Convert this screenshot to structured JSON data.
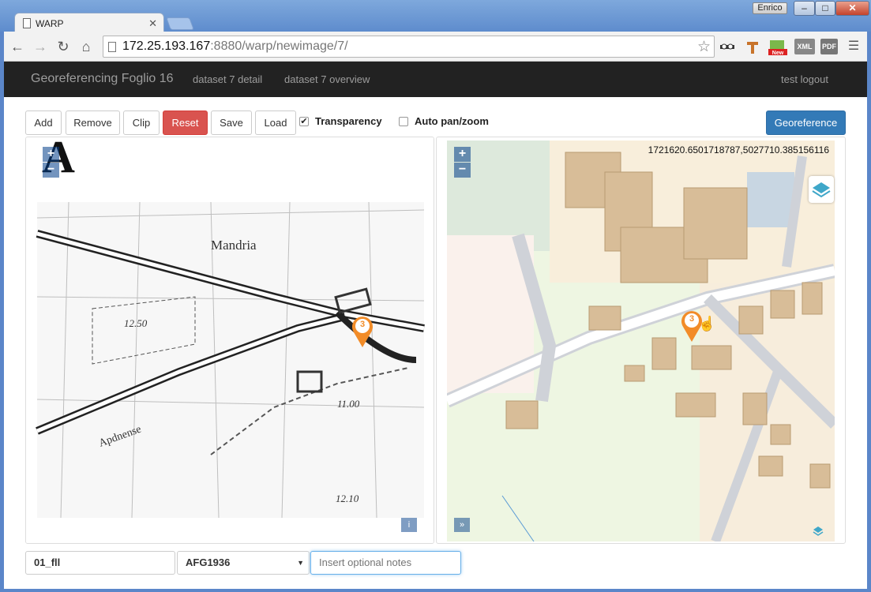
{
  "browser": {
    "tab_title": "WARP",
    "url_host": "172.25.193.167",
    "url_rest": ":8880/warp/newimage/7/",
    "user": "Enrico",
    "extensions": [
      "incognito-icon",
      "hammer-icon",
      "new-badge-icon",
      "xml-icon",
      "pdf-icon"
    ],
    "ext_labels": {
      "new": "New",
      "xml": "XML",
      "pdf": "PDF"
    }
  },
  "app": {
    "brand": "Georeferencing Foglio 16",
    "nav": [
      "dataset 7 detail",
      "dataset 7 overview"
    ],
    "user_link": "test logout"
  },
  "toolbar": {
    "add": "Add",
    "remove": "Remove",
    "clip": "Clip",
    "reset": "Reset",
    "save": "Save",
    "load": "Load",
    "transparency": "Transparency",
    "transparency_checked": true,
    "autopan": "Auto pan/zoom",
    "autopan_checked": false,
    "georeference": "Georeference",
    "colors": {
      "reset": "#d9534f",
      "georeference": "#337ab7"
    }
  },
  "left_map": {
    "labels": [
      "Mandria",
      "12.50",
      "11.00",
      "Apdnense",
      "12.10"
    ],
    "header_letter": "A",
    "marker": "3",
    "zoom_in": "+",
    "zoom_out": "−",
    "info_btn": "i"
  },
  "right_map": {
    "coordinates": "1721620.6501718787,5027710.385156116",
    "marker": "3",
    "zoom_in": "+",
    "zoom_out": "−",
    "expand_btn": "»"
  },
  "form": {
    "name_value": "01_fll",
    "crs_value": "AFG1936",
    "notes_placeholder": "Insert optional notes"
  }
}
